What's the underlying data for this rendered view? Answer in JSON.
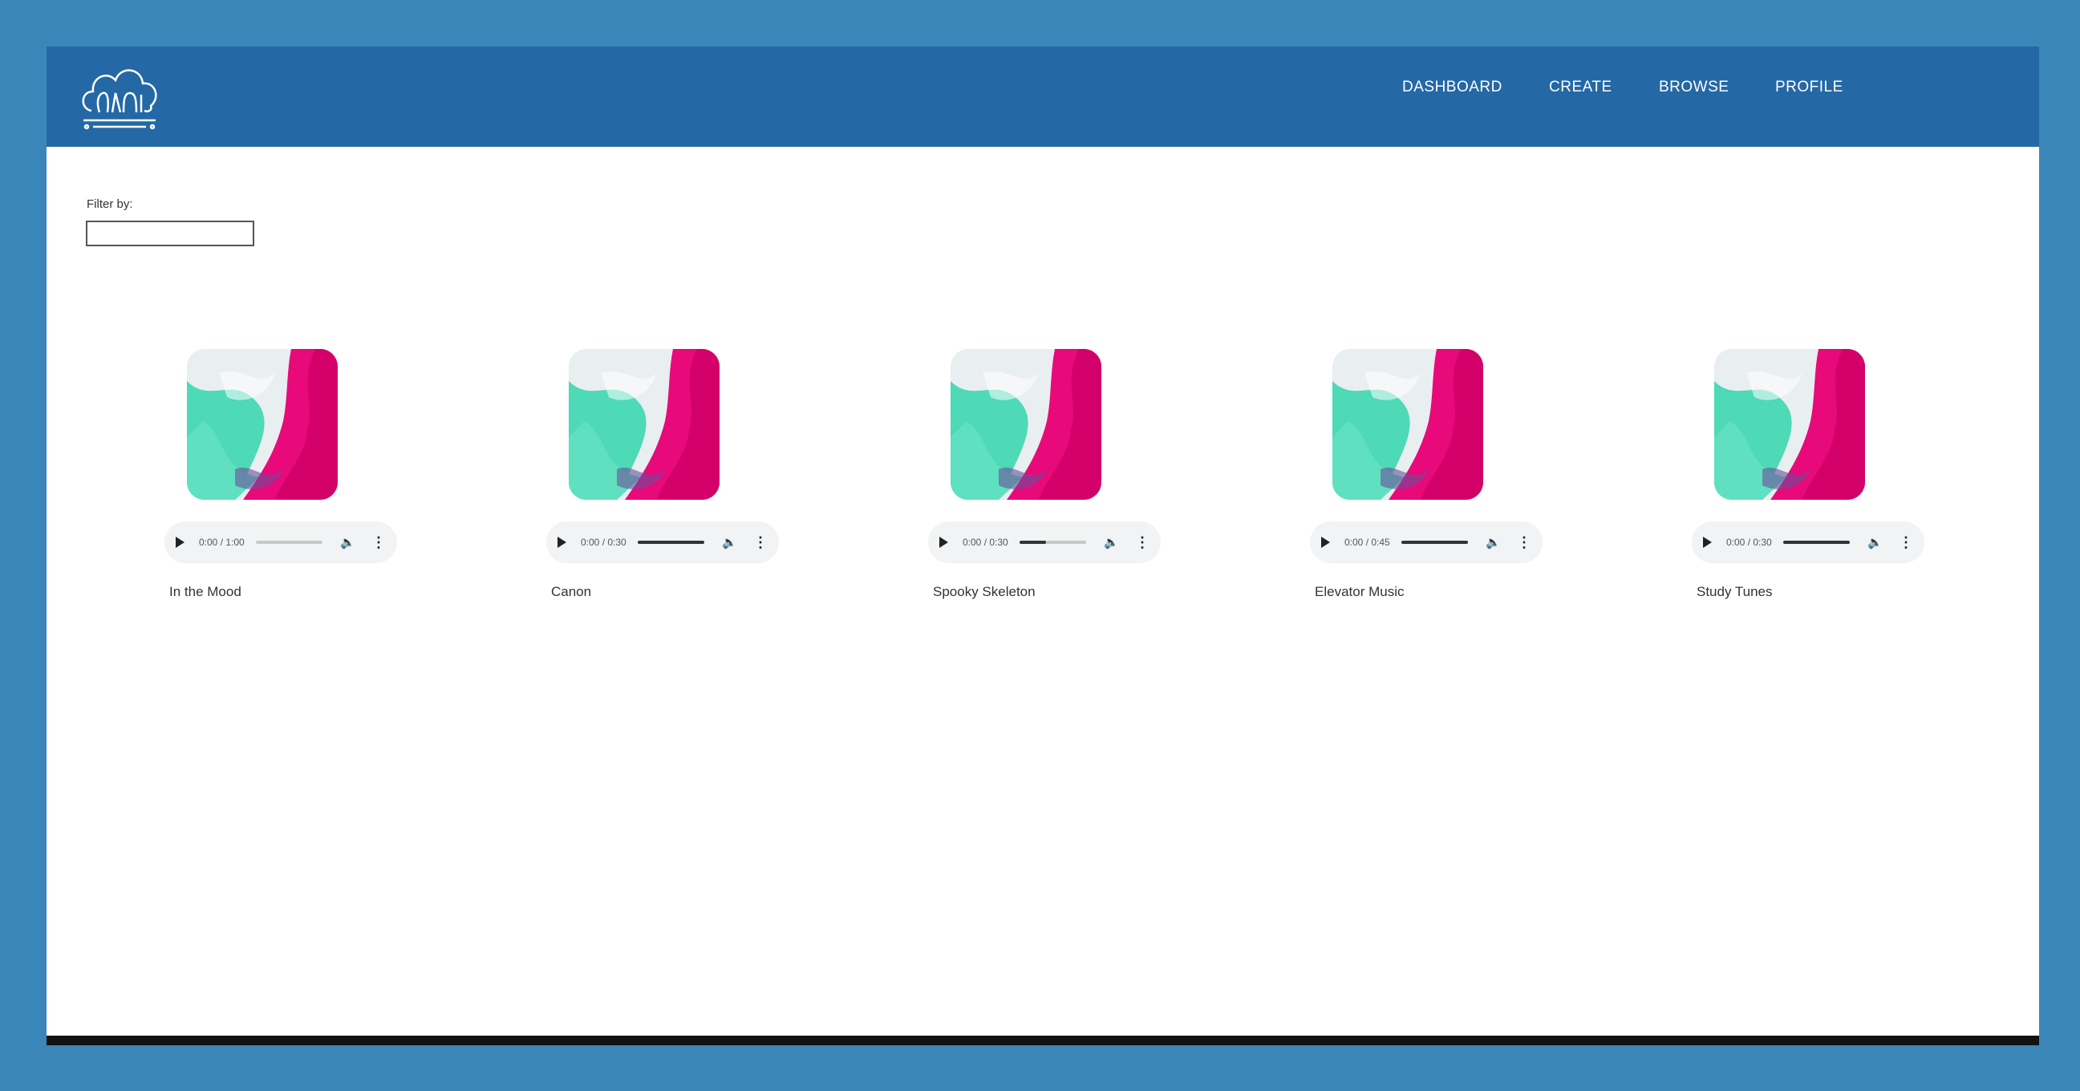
{
  "nav": {
    "items": [
      {
        "label": "DASHBOARD"
      },
      {
        "label": "CREATE"
      },
      {
        "label": "BROWSE"
      },
      {
        "label": "PROFILE"
      }
    ]
  },
  "filter": {
    "label": "Filter by:",
    "value": ""
  },
  "tracks": [
    {
      "title": "In the Mood",
      "time": "0:00 / 1:00",
      "progress": 0.0
    },
    {
      "title": "Canon",
      "time": "0:00 / 0:30",
      "progress": 1.0
    },
    {
      "title": "Spooky Skeleton",
      "time": "0:00 / 0:30",
      "progress": 0.4
    },
    {
      "title": "Elevator Music",
      "time": "0:00 / 0:45",
      "progress": 1.0
    },
    {
      "title": "Study Tunes",
      "time": "0:00 / 0:30",
      "progress": 1.0
    }
  ],
  "colors": {
    "page_background": "#3a86b8",
    "navbar": "#2468a6",
    "cover_teal": "#3dd6b0",
    "cover_pink": "#e8097a"
  },
  "icons": [
    "logo-icon",
    "play-icon",
    "volume-icon",
    "more-options-icon"
  ]
}
